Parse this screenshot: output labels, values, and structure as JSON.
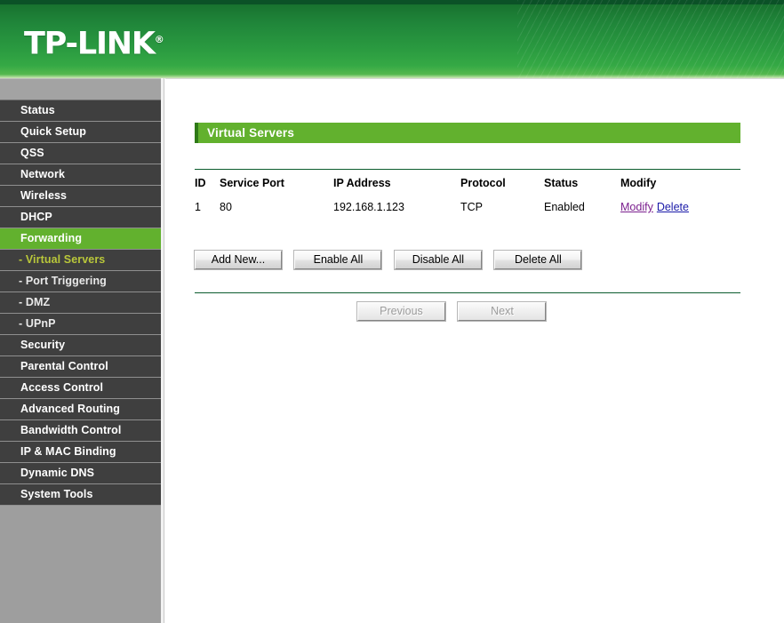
{
  "brand": {
    "name": "TP-LINK",
    "registered_mark": "®"
  },
  "sidebar": {
    "items": [
      {
        "label": "Status",
        "state": "normal",
        "level": "top"
      },
      {
        "label": "Quick Setup",
        "state": "normal",
        "level": "top"
      },
      {
        "label": "QSS",
        "state": "normal",
        "level": "top"
      },
      {
        "label": "Network",
        "state": "normal",
        "level": "top"
      },
      {
        "label": "Wireless",
        "state": "normal",
        "level": "top"
      },
      {
        "label": "DHCP",
        "state": "normal",
        "level": "top"
      },
      {
        "label": "Forwarding",
        "state": "active",
        "level": "top"
      },
      {
        "label": "- Virtual Servers",
        "state": "sub-active",
        "level": "sub"
      },
      {
        "label": "- Port Triggering",
        "state": "normal",
        "level": "sub"
      },
      {
        "label": "- DMZ",
        "state": "normal",
        "level": "sub"
      },
      {
        "label": "- UPnP",
        "state": "normal",
        "level": "sub"
      },
      {
        "label": "Security",
        "state": "normal",
        "level": "top"
      },
      {
        "label": "Parental Control",
        "state": "normal",
        "level": "top"
      },
      {
        "label": "Access Control",
        "state": "normal",
        "level": "top"
      },
      {
        "label": "Advanced Routing",
        "state": "normal",
        "level": "top"
      },
      {
        "label": "Bandwidth Control",
        "state": "normal",
        "level": "top"
      },
      {
        "label": "IP & MAC Binding",
        "state": "normal",
        "level": "top"
      },
      {
        "label": "Dynamic DNS",
        "state": "normal",
        "level": "top"
      },
      {
        "label": "System Tools",
        "state": "normal",
        "level": "top"
      }
    ]
  },
  "main": {
    "page_title": "Virtual Servers",
    "table": {
      "headers": {
        "id": "ID",
        "service_port": "Service Port",
        "ip_address": "IP Address",
        "protocol": "Protocol",
        "status": "Status",
        "modify": "Modify"
      },
      "rows": [
        {
          "id": "1",
          "service_port": "80",
          "ip_address": "192.168.1.123",
          "protocol": "TCP",
          "status": "Enabled",
          "modify_link": "Modify",
          "delete_link": "Delete"
        }
      ]
    },
    "actions": {
      "add_new": "Add New...",
      "enable_all": "Enable All",
      "disable_all": "Disable All",
      "delete_all": "Delete All"
    },
    "pagination": {
      "previous": "Previous",
      "next": "Next",
      "previous_enabled": false,
      "next_enabled": false
    }
  },
  "colors": {
    "brand_green": "#2a9a40",
    "accent_green": "#62b12e",
    "sidebar_item_bg": "#3f3f3f",
    "sidebar_bg": "#9e9e9e",
    "sub_active_text": "#b9c73a",
    "link_modify": "#7b1f8e",
    "link_delete": "#1a1aa8",
    "divider_green": "#0c5c2e"
  }
}
